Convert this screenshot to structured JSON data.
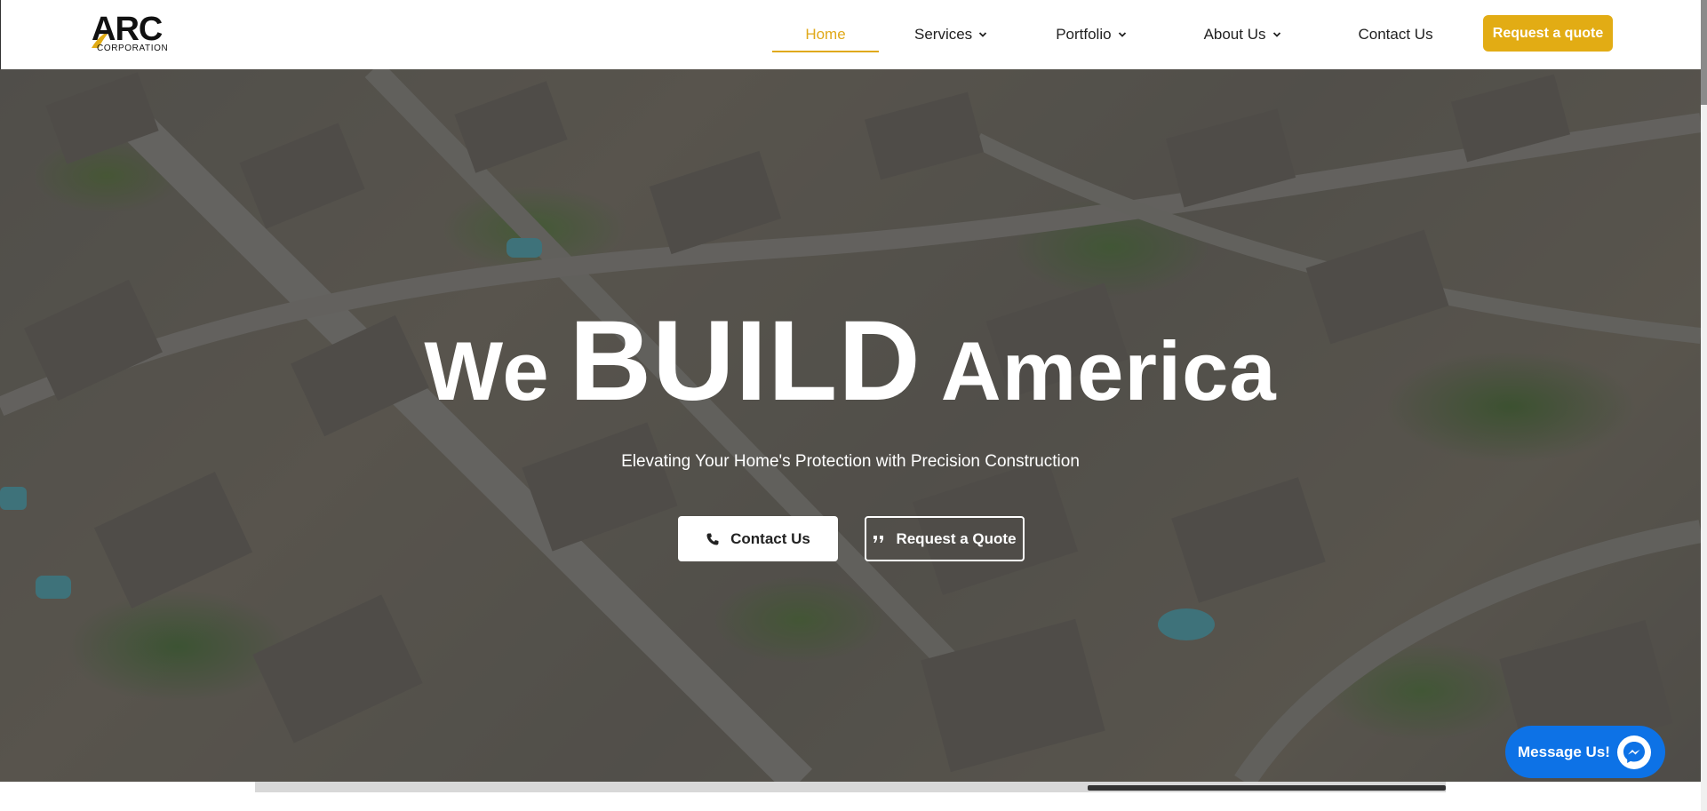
{
  "brand": {
    "name": "ARC",
    "tagline": "CORPORATION",
    "accent_color": "#e2ac14"
  },
  "nav": {
    "items": [
      {
        "label": "Home",
        "active": true,
        "has_dropdown": false
      },
      {
        "label": "Services",
        "active": false,
        "has_dropdown": true
      },
      {
        "label": "Portfolio",
        "active": false,
        "has_dropdown": true
      },
      {
        "label": "About Us",
        "active": false,
        "has_dropdown": true
      },
      {
        "label": "Contact Us",
        "active": false,
        "has_dropdown": false
      }
    ],
    "cta_label": "Request a quote"
  },
  "hero": {
    "title_word1": "We",
    "title_word2": "BUILD",
    "title_word3": "America",
    "subtitle": "Elevating Your Home's Protection with Precision Construction",
    "contact_button": {
      "label": "Contact Us",
      "icon": "phone-icon"
    },
    "quote_button": {
      "label": "Request a Quote",
      "icon": "quote-icon"
    },
    "background": "aerial-neighborhood-photo"
  },
  "messenger": {
    "label": "Message Us!",
    "icon": "messenger-icon",
    "color": "#0d72e6"
  }
}
